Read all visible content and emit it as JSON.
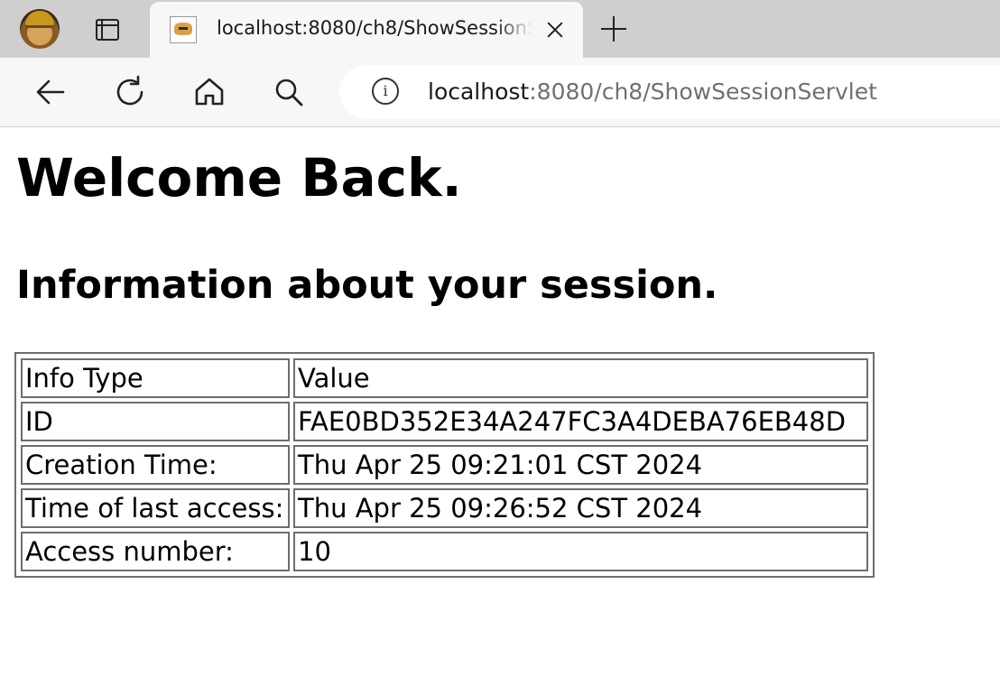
{
  "browser": {
    "tab": {
      "title": "localhost:8080/ch8/ShowSessionServlet"
    },
    "address": {
      "host": "localhost",
      "rest": ":8080/ch8/ShowSessionServlet"
    },
    "icons": {
      "profile": "profile-avatar-icon",
      "tab_actions": "tab-actions-icon",
      "favicon": "tomcat-favicon-icon",
      "close": "close-icon",
      "new_tab": "plus-icon",
      "back": "back-arrow-icon",
      "refresh": "refresh-icon",
      "home": "home-icon",
      "search": "search-icon",
      "info": "info-icon"
    },
    "info_glyph": "i"
  },
  "page": {
    "heading": "Welcome Back.",
    "subheading": "Information about your session.",
    "table": {
      "header": [
        "Info Type",
        "Value"
      ],
      "rows": [
        [
          "ID",
          "FAE0BD352E34A247FC3A4DEBA76EB48D"
        ],
        [
          "Creation Time:",
          "Thu Apr 25 09:21:01 CST 2024"
        ],
        [
          "Time of last access:",
          "Thu Apr 25 09:26:52 CST 2024"
        ],
        [
          "Access number:",
          "10"
        ]
      ]
    }
  }
}
